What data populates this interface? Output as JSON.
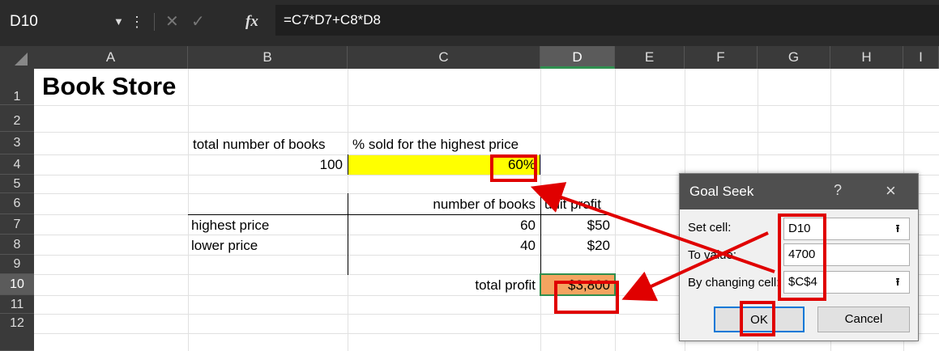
{
  "formula_bar": {
    "name_box": "D10",
    "name_box_dropdown_icon": "chevron-down-icon",
    "cancel_icon": "close-icon",
    "enter_icon": "check-icon",
    "fx_label": "fx",
    "formula": "=C7*D7+C8*D8"
  },
  "columns": [
    "A",
    "B",
    "C",
    "D",
    "E",
    "F",
    "G",
    "H",
    "I"
  ],
  "rows": [
    "1",
    "2",
    "3",
    "4",
    "5",
    "6",
    "7",
    "8",
    "9",
    "10",
    "11",
    "12"
  ],
  "selected_cell": "D10",
  "cells": {
    "A1": "Book Store",
    "B3": "total number of books",
    "C3": "% sold for the highest price",
    "B4": "100",
    "C4": "60%",
    "C6": "number of books",
    "D6": "unit profit",
    "B7": "highest price",
    "C7": "60",
    "D7": "$50",
    "B8": "lower price",
    "C8": "40",
    "D8": "$20",
    "C10": "total profit",
    "D10": "$3,800"
  },
  "colors": {
    "input_cell_fill": "#ffff00",
    "result_cell_fill": "#f4a460",
    "annotation_red": "#e00000",
    "selection_green": "#2f8f4f"
  },
  "dialog": {
    "title": "Goal Seek",
    "help": "?",
    "close": "×",
    "set_cell_label": "Set cell:",
    "set_cell_value": "D10",
    "to_value_label": "To value:",
    "to_value_value": "4700",
    "changing_cell_label": "By changing cell:",
    "changing_cell_value": "$C$4",
    "ok_label": "OK",
    "cancel_label": "Cancel"
  }
}
